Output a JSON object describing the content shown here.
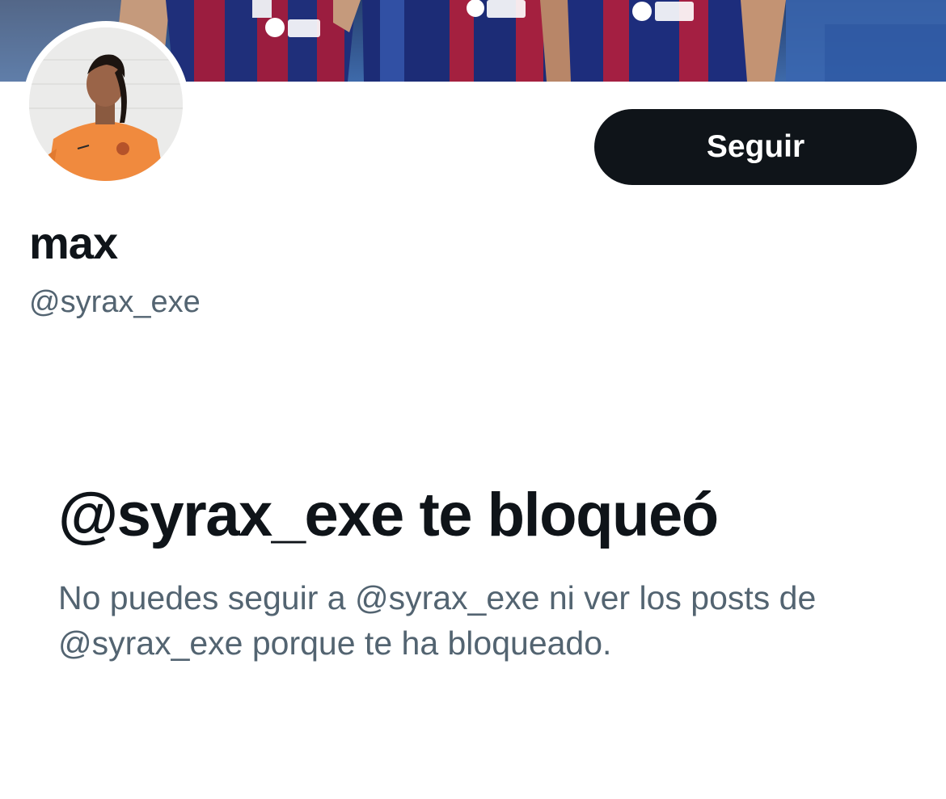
{
  "profile": {
    "display_name": "max",
    "handle": "@syrax_exe",
    "follow_label": "Seguir",
    "banner_icon": "banner-photo-icon",
    "avatar_icon": "avatar-photo-icon"
  },
  "blocked_notice": {
    "title": "@syrax_exe te bloqueó",
    "message": "No puedes seguir a @syrax_exe ni ver los posts de @syrax_exe porque te ha bloqueado."
  },
  "colors": {
    "text_primary": "#0f1419",
    "text_secondary": "#536471",
    "button_bg": "#0f1419",
    "button_text": "#ffffff",
    "background": "#ffffff"
  }
}
